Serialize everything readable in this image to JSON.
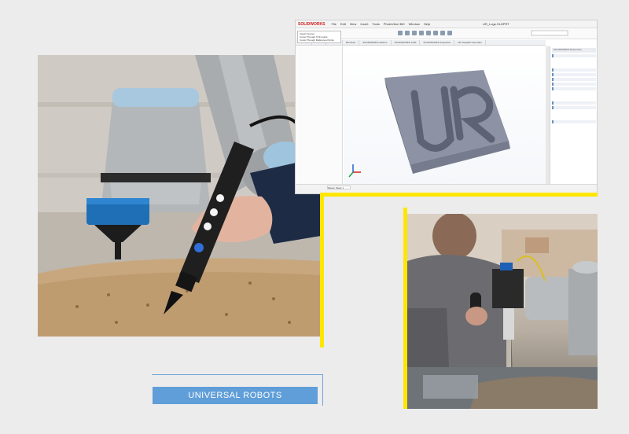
{
  "caption": {
    "text": "UNIVERSAL ROBOTS"
  },
  "cad": {
    "app_logo": "SOLIDWORKS",
    "menu": [
      "File",
      "Edit",
      "View",
      "Insert",
      "Tools",
      "PhotoView 360",
      "Window",
      "Help"
    ],
    "doc_title": "UR_Logo.SLDPRT",
    "tooltip": [
      "Import Curves",
      "Curve Through XYZ points",
      "Curve Through Reference Points"
    ],
    "tabs": [
      "Features",
      "Sketch",
      "Evaluate",
      "DimXpert",
      "SOLIDWORKS Add-Ins",
      "SOLIDWORKS CAM",
      "SOLIDWORKS Inspection",
      "UR Toolpath Generator"
    ],
    "taskpane_title": "SOLIDWORKS Resources",
    "status_tab": "Motion Study 1"
  },
  "colors": {
    "accent_yellow": "#ffe600",
    "caption_blue": "#5f9ed8",
    "rule_blue": "#6fa4d6",
    "ur_blue": "#1f6fb6"
  },
  "icons": {
    "pen_buttons": [
      "white-dot",
      "white-dot",
      "white-dot",
      "blue-dot"
    ]
  }
}
